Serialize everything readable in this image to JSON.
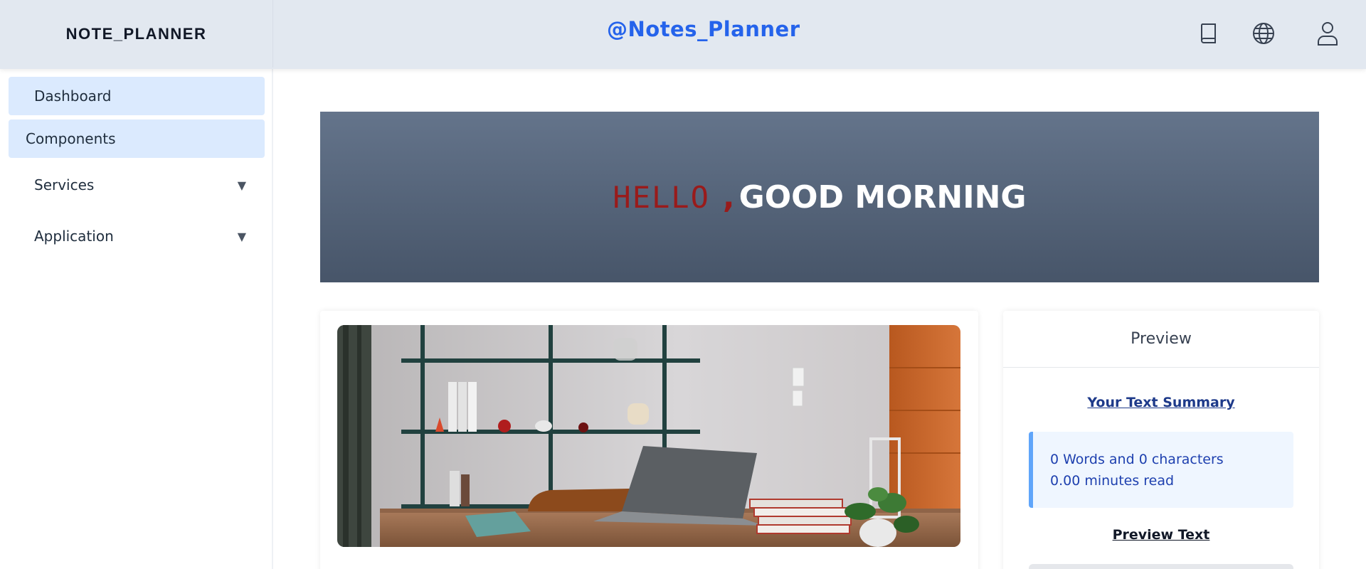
{
  "header": {
    "brand": "NOTE_PLANNER",
    "title": "@Notes_Planner",
    "icons": [
      "book-icon",
      "globe-icon",
      "user-icon"
    ]
  },
  "sidebar": {
    "items": [
      {
        "label": "Dashboard",
        "active": true
      },
      {
        "label": "Components",
        "active": true
      },
      {
        "label": "Services",
        "arrow": "▼"
      },
      {
        "label": "Application",
        "arrow": "▼"
      }
    ]
  },
  "banner": {
    "hello": "HELLO",
    "comma": ",",
    "greeting": "GOOD MORNING"
  },
  "preview": {
    "heading": "Preview",
    "summary_title": "Your Text Summary",
    "words_line": "0 Words and 0 characters",
    "read_line": "0.00 minutes read",
    "preview_text_title": "Preview Text"
  },
  "colors": {
    "header_bg": "#e2e8f0",
    "accent": "#2563eb",
    "sidebar_active": "#dbeafe",
    "banner_top": "#64748b",
    "banner_bottom": "#475569",
    "hello": "#991b1b",
    "stats_bg": "#eff6ff",
    "stats_border": "#60a5fa"
  }
}
